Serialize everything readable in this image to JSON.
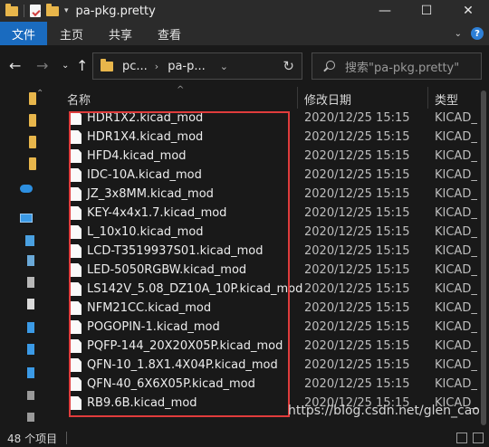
{
  "window": {
    "title": "pa-pkg.pretty",
    "minimize_glyph": "—",
    "maximize_glyph": "☐",
    "close_glyph": "✕"
  },
  "ribbon": {
    "tabs": [
      {
        "label": "文件"
      },
      {
        "label": "主页"
      },
      {
        "label": "共享"
      },
      {
        "label": "查看"
      }
    ],
    "help": "?"
  },
  "address": {
    "crumbs": [
      "pc...",
      "pa-p..."
    ],
    "search_placeholder": "搜索\"pa-pkg.pretty\""
  },
  "columns": {
    "name": "名称",
    "date": "修改日期",
    "type": "类型"
  },
  "files": [
    {
      "name": "HDR1X2.kicad_mod",
      "date": "2020/12/25 15:15",
      "type": "KICAD_M"
    },
    {
      "name": "HDR1X4.kicad_mod",
      "date": "2020/12/25 15:15",
      "type": "KICAD_M"
    },
    {
      "name": "HFD4.kicad_mod",
      "date": "2020/12/25 15:15",
      "type": "KICAD_M"
    },
    {
      "name": "IDC-10A.kicad_mod",
      "date": "2020/12/25 15:15",
      "type": "KICAD_M"
    },
    {
      "name": "JZ_3x8MM.kicad_mod",
      "date": "2020/12/25 15:15",
      "type": "KICAD_M"
    },
    {
      "name": "KEY-4x4x1.7.kicad_mod",
      "date": "2020/12/25 15:15",
      "type": "KICAD_M"
    },
    {
      "name": "L_10x10.kicad_mod",
      "date": "2020/12/25 15:15",
      "type": "KICAD_M"
    },
    {
      "name": "LCD-T3519937S01.kicad_mod",
      "date": "2020/12/25 15:15",
      "type": "KICAD_M"
    },
    {
      "name": "LED-5050RGBW.kicad_mod",
      "date": "2020/12/25 15:15",
      "type": "KICAD_M"
    },
    {
      "name": "LS142V_5.08_DZ10A_10P.kicad_mod",
      "date": "2020/12/25 15:15",
      "type": "KICAD_M"
    },
    {
      "name": "NFM21CC.kicad_mod",
      "date": "2020/12/25 15:15",
      "type": "KICAD_M"
    },
    {
      "name": "POGOPIN-1.kicad_mod",
      "date": "2020/12/25 15:15",
      "type": "KICAD_M"
    },
    {
      "name": "PQFP-144_20X20X05P.kicad_mod",
      "date": "2020/12/25 15:15",
      "type": "KICAD_M"
    },
    {
      "name": "QFN-10_1.8X1.4X04P.kicad_mod",
      "date": "2020/12/25 15:15",
      "type": "KICAD_M"
    },
    {
      "name": "QFN-40_6X6X05P.kicad_mod",
      "date": "2020/12/25 15:15",
      "type": "KICAD_M"
    },
    {
      "name": "RB9.6B.kicad_mod",
      "date": "2020/12/25 15:15",
      "type": "KICAD_M"
    }
  ],
  "status": {
    "item_count": "48 个项目"
  },
  "watermark": "https://blog.csdn.net/glen_cao",
  "colors": {
    "accent": "#1a6bbf",
    "highlight": "#e03c3c",
    "folder": "#e8b64b"
  }
}
